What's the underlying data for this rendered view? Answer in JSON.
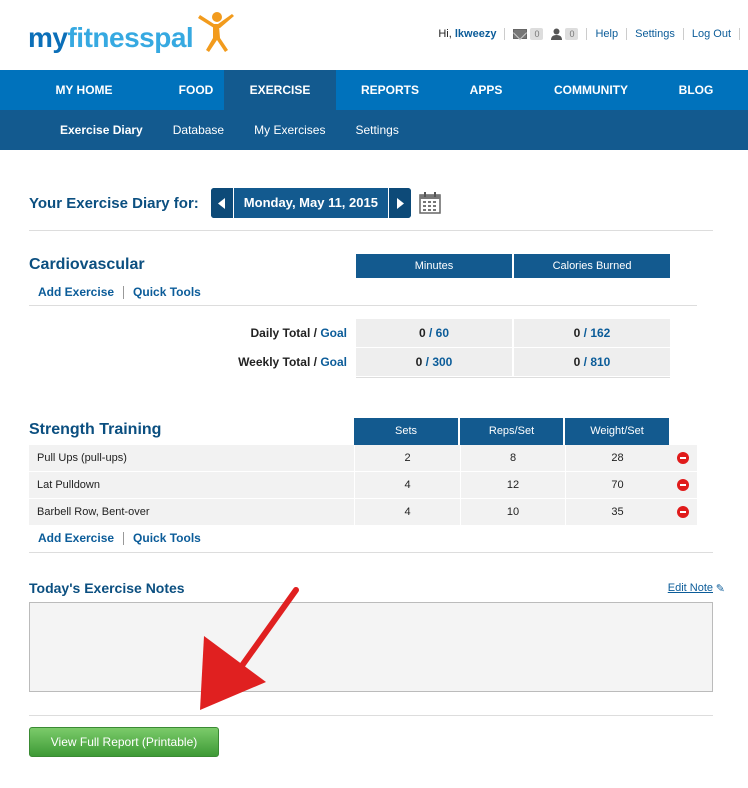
{
  "header": {
    "logo_text_a": "my",
    "logo_text_b": "fitnesspal",
    "greeting_prefix": "Hi,",
    "username": "lkweezy",
    "messages_count": "0",
    "friends_count": "0",
    "help": "Help",
    "settings": "Settings",
    "logout": "Log Out"
  },
  "nav": {
    "items": [
      {
        "label": "MY HOME"
      },
      {
        "label": "FOOD"
      },
      {
        "label": "EXERCISE"
      },
      {
        "label": "REPORTS"
      },
      {
        "label": "APPS"
      },
      {
        "label": "COMMUNITY"
      },
      {
        "label": "BLOG"
      }
    ],
    "active_index": 2
  },
  "subnav": {
    "items": [
      {
        "label": "Exercise Diary"
      },
      {
        "label": "Database"
      },
      {
        "label": "My Exercises"
      },
      {
        "label": "Settings"
      }
    ]
  },
  "diary": {
    "title": "Your Exercise Diary for:",
    "date": "Monday, May 11, 2015"
  },
  "cardio": {
    "title": "Cardiovascular",
    "col_minutes": "Minutes",
    "col_calories": "Calories Burned",
    "add_exercise": "Add Exercise",
    "quick_tools": "Quick Tools",
    "daily_label": "Daily Total /",
    "weekly_label": "Weekly Total /",
    "goal_link": "Goal",
    "daily_minutes": "0",
    "daily_minutes_goal": "/ 60",
    "daily_calories": "0",
    "daily_calories_goal": "/ 162",
    "weekly_minutes": "0",
    "weekly_minutes_goal": "/ 300",
    "weekly_calories": "0",
    "weekly_calories_goal": "/ 810"
  },
  "strength": {
    "title": "Strength Training",
    "col_sets": "Sets",
    "col_reps": "Reps/Set",
    "col_weight": "Weight/Set",
    "rows": [
      {
        "name": "Pull Ups (pull-ups)",
        "sets": "2",
        "reps": "8",
        "weight": "28"
      },
      {
        "name": "Lat Pulldown",
        "sets": "4",
        "reps": "12",
        "weight": "70"
      },
      {
        "name": "Barbell Row, Bent-over",
        "sets": "4",
        "reps": "10",
        "weight": "35"
      }
    ],
    "add_exercise": "Add Exercise",
    "quick_tools": "Quick Tools"
  },
  "notes": {
    "title": "Today's Exercise Notes",
    "edit_note": "Edit Note",
    "pencil": "✎"
  },
  "report_button": "View Full Report (Printable)",
  "colors": {
    "nav_blue": "#0072bc",
    "dark_blue": "#135a8f",
    "link_blue": "#0b5c99",
    "green": "#4caf3f",
    "annotation_arrow": "#e02020"
  }
}
